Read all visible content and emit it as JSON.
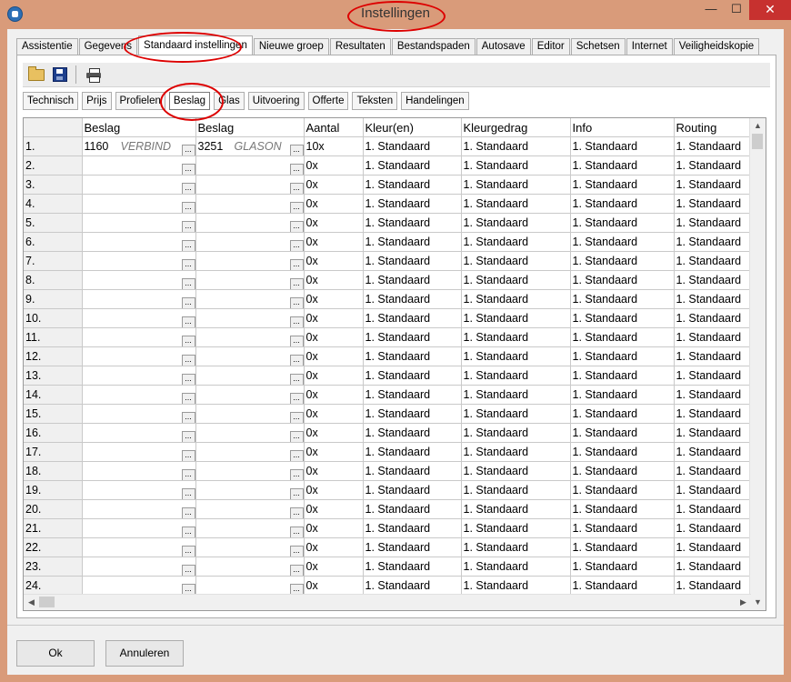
{
  "window": {
    "title": "Instellingen",
    "minimize_glyph": "—",
    "maximize_glyph": "☐",
    "close_glyph": "✕"
  },
  "tabs": [
    "Assistentie",
    "Gegevens",
    "Standaard instellingen",
    "Nieuwe groep",
    "Resultaten",
    "Bestandspaden",
    "Autosave",
    "Editor",
    "Schetsen",
    "Internet",
    "Veiligheidskopie"
  ],
  "active_tab": "Standaard instellingen",
  "toolbar": {
    "icons": [
      "open-folder-icon",
      "save-icon",
      "print-icon"
    ]
  },
  "subtabs": [
    "Technisch",
    "Prijs",
    "Profielen",
    "Beslag",
    "Glas",
    "Uitvoering",
    "Offerte",
    "Teksten",
    "Handelingen"
  ],
  "active_subtab": "Beslag",
  "grid": {
    "headers": [
      "",
      "Beslag",
      "Beslag",
      "Aantal",
      "Kleur(en)",
      "Kleurgedrag",
      "Info",
      "Routing"
    ],
    "first_row": {
      "beslag1_code": "1160",
      "beslag1_desc": "VERBIND",
      "beslag2_code": "3251",
      "beslag2_desc": "GLASON",
      "aantal": "10x"
    },
    "row_count": 24,
    "row_label_suffix": ".",
    "default_aantal": "0x",
    "default_standaard": "1. Standaard",
    "ellipsis": "..."
  },
  "buttons": {
    "ok": "Ok",
    "cancel": "Annuleren"
  },
  "colors": {
    "window_frame": "#d99b7a",
    "close_button": "#c7312f",
    "annotation": "#dd0000"
  }
}
